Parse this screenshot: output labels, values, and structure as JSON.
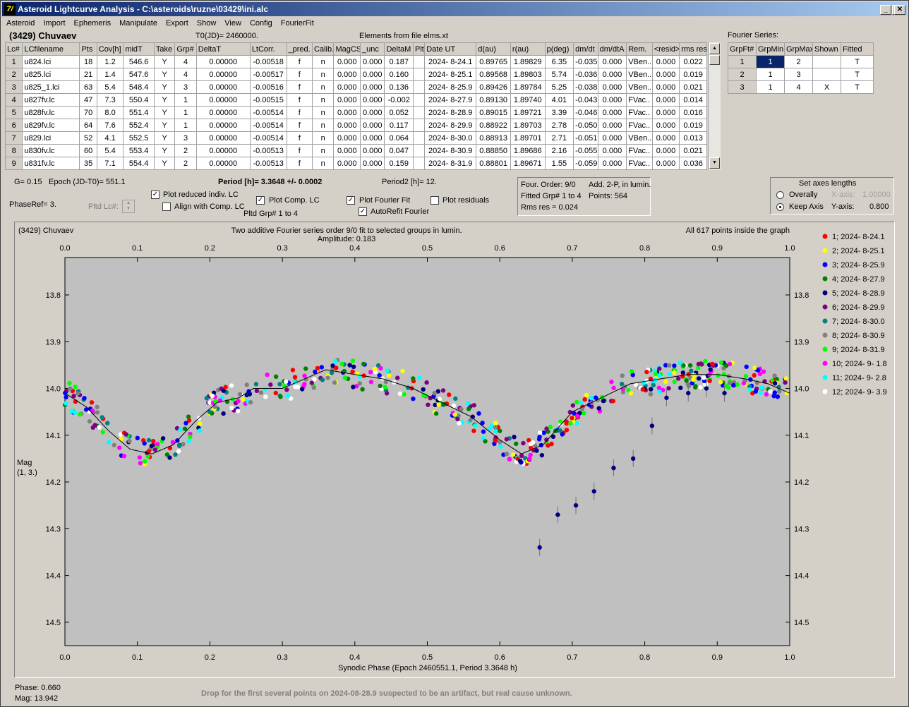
{
  "window": {
    "title": "Asteroid Lightcurve Analysis - C:\\asteroids\\ruzne\\03429\\ini.alc",
    "icon": "7/",
    "min_label": "_",
    "max_label": "□",
    "close_label": "✕"
  },
  "menu": [
    "Asteroid",
    "Import",
    "Ephemeris",
    "Manipulate",
    "Export",
    "Show",
    "View",
    "Config",
    "FourierFit"
  ],
  "header": {
    "asteroid": "(3429) Chuvaev",
    "t0": "T0(JD)= 2460000.",
    "elements": "Elements from file elms.xt"
  },
  "lc_table": {
    "columns": [
      "Lc#",
      "LCfilename",
      "Pts",
      "Cov[h]",
      "midT",
      "Take",
      "Grp#",
      "DeltaT",
      "LtCorr.",
      "_pred.",
      "Calib.",
      "MagCS",
      "_unc",
      "DeltaM",
      "Plt",
      "Date UT",
      "d(au)",
      "r(au)",
      "p(deg)",
      "dm/dt",
      "dm/dtA",
      "Rem.",
      "<resid>",
      "rms res"
    ],
    "rows": [
      [
        "1",
        "u824.lci",
        "18",
        "1.2",
        "546.6",
        "Y",
        "4",
        "0.00000",
        "-0.00518",
        "f",
        "n",
        "0.000",
        "0.000",
        "0.187",
        "",
        "2024- 8-24.1",
        "0.89765",
        "1.89829",
        "6.35",
        "-0.035",
        "0.000",
        "VBen..",
        "0.000",
        "0.022"
      ],
      [
        "2",
        "u825.lci",
        "21",
        "1.4",
        "547.6",
        "Y",
        "4",
        "0.00000",
        "-0.00517",
        "f",
        "n",
        "0.000",
        "0.000",
        "0.160",
        "",
        "2024- 8-25.1",
        "0.89568",
        "1.89803",
        "5.74",
        "-0.036",
        "0.000",
        "VBen..",
        "0.000",
        "0.019"
      ],
      [
        "3",
        "u825_1.lci",
        "63",
        "5.4",
        "548.4",
        "Y",
        "3",
        "0.00000",
        "-0.00516",
        "f",
        "n",
        "0.000",
        "0.000",
        "0.136",
        "",
        "2024- 8-25.9",
        "0.89426",
        "1.89784",
        "5.25",
        "-0.038",
        "0.000",
        "VBen..",
        "0.000",
        "0.021"
      ],
      [
        "4",
        "u827fv.lc",
        "47",
        "7.3",
        "550.4",
        "Y",
        "1",
        "0.00000",
        "-0.00515",
        "f",
        "n",
        "0.000",
        "0.000",
        "-0.002",
        "",
        "2024- 8-27.9",
        "0.89130",
        "1.89740",
        "4.01",
        "-0.043",
        "0.000",
        "FVac..",
        "0.000",
        "0.014"
      ],
      [
        "5",
        "u828fv.lc",
        "70",
        "8.0",
        "551.4",
        "Y",
        "1",
        "0.00000",
        "-0.00514",
        "f",
        "n",
        "0.000",
        "0.000",
        "0.052",
        "",
        "2024- 8-28.9",
        "0.89015",
        "1.89721",
        "3.39",
        "-0.046",
        "0.000",
        "FVac..",
        "0.000",
        "0.016"
      ],
      [
        "6",
        "u829fv.lc",
        "64",
        "7.6",
        "552.4",
        "Y",
        "1",
        "0.00000",
        "-0.00514",
        "f",
        "n",
        "0.000",
        "0.000",
        "0.117",
        "",
        "2024- 8-29.9",
        "0.88922",
        "1.89703",
        "2.78",
        "-0.050",
        "0.000",
        "FVac..",
        "0.000",
        "0.019"
      ],
      [
        "7",
        "u829.lci",
        "52",
        "4.1",
        "552.5",
        "Y",
        "3",
        "0.00000",
        "-0.00514",
        "f",
        "n",
        "0.000",
        "0.000",
        "0.064",
        "",
        "2024- 8-30.0",
        "0.88913",
        "1.89701",
        "2.71",
        "-0.051",
        "0.000",
        "VBen..",
        "0.000",
        "0.013"
      ],
      [
        "8",
        "u830fv.lc",
        "60",
        "5.4",
        "553.4",
        "Y",
        "2",
        "0.00000",
        "-0.00513",
        "f",
        "n",
        "0.000",
        "0.000",
        "0.047",
        "",
        "2024- 8-30.9",
        "0.88850",
        "1.89686",
        "2.16",
        "-0.055",
        "0.000",
        "FVac..",
        "0.000",
        "0.021"
      ],
      [
        "9",
        "u831fv.lc",
        "35",
        "7.1",
        "554.4",
        "Y",
        "2",
        "0.00000",
        "-0.00513",
        "f",
        "n",
        "0.000",
        "0.000",
        "0.159",
        "",
        "2024- 8-31.9",
        "0.88801",
        "1.89671",
        "1.55",
        "-0.059",
        "0.000",
        "FVac..",
        "0.000",
        "0.036"
      ]
    ]
  },
  "fourier_table": {
    "title": "Fourier Series:",
    "columns": [
      "GrpFt#",
      "GrpMin",
      "GrpMax",
      "Shown",
      "Fitted"
    ],
    "rows": [
      [
        "1",
        "1",
        "2",
        "",
        "T"
      ],
      [
        "2",
        "1",
        "3",
        "",
        "T"
      ],
      [
        "3",
        "1",
        "4",
        "X",
        "T"
      ]
    ]
  },
  "params": {
    "g": "G= 0.15",
    "epoch": "Epoch (JD-T0)= 551.1",
    "period": "Period [h]= 3.3648 +/- 0.0002",
    "period2": "Period2 [h]= 12.",
    "phaseref": "PhaseRef= 3.",
    "pltd_lc": "Pltd Lc#:"
  },
  "checks": {
    "plot_reduced": "Plot reduced indiv. LC",
    "align": "Align with Comp. LC",
    "plot_comp": "Plot Comp. LC",
    "pltd_grp": "Pltd Grp#  1   to   4",
    "plot_fourier": "Plot Fourier Fit",
    "autorefit": "AutoRefit Fourier",
    "plot_resid": "Plot residuals"
  },
  "fit_info": {
    "order": "Four. Order:  9/0",
    "add": "Add. 2-P, in lumin.",
    "fitted": "Fitted Grp# 1 to 4",
    "points": "Points: 564",
    "rms": "Rms res      = 0.024"
  },
  "axes_box": {
    "title": "Set axes lengths",
    "overall": "Overally",
    "keep": "Keep Axis",
    "xaxis": "X-axis:",
    "xval": "1.00000",
    "yaxis": "Y-axis:",
    "yval": "0.800"
  },
  "chart_data": {
    "type": "scatter",
    "title_left": "(3429) Chuvaev",
    "title": "Two additive Fourier series order 9/0 fit to selected groups in lumin.",
    "subtitle": "Amplitude: 0.183",
    "note": "All 617 points inside the graph",
    "xlabel": "Synodic Phase (Epoch 2460551.1, Period 3.3648 h)",
    "ylabel": "Mag",
    "ylabel2": "(1, 3.)",
    "xlim": [
      0,
      1
    ],
    "ylim": [
      14.55,
      13.72
    ],
    "xticks": [
      "0.0",
      "0.1",
      "0.2",
      "0.3",
      "0.4",
      "0.5",
      "0.6",
      "0.7",
      "0.8",
      "0.9",
      "1.0"
    ],
    "yticks": [
      "13.8",
      "13.9",
      "14.0",
      "14.1",
      "14.2",
      "14.3",
      "14.4",
      "14.5"
    ],
    "legend": [
      {
        "name": "1; 2024- 8-24.1",
        "color": "#ff0000"
      },
      {
        "name": "2; 2024- 8-25.1",
        "color": "#ffff00"
      },
      {
        "name": "3; 2024- 8-25.9",
        "color": "#0000ff"
      },
      {
        "name": "4; 2024- 8-27.9",
        "color": "#008000"
      },
      {
        "name": "5; 2024- 8-28.9",
        "color": "#000080"
      },
      {
        "name": "6; 2024- 8-29.9",
        "color": "#800080"
      },
      {
        "name": "7; 2024- 8-30.0",
        "color": "#008080"
      },
      {
        "name": "8; 2024- 8-30.9",
        "color": "#808080"
      },
      {
        "name": "9; 2024- 8-31.9",
        "color": "#00ff00"
      },
      {
        "name": "10; 2024- 9- 1.8",
        "color": "#ff00ff"
      },
      {
        "name": "11; 2024- 9- 2.8",
        "color": "#00ffff"
      },
      {
        "name": "12; 2024- 9- 3.9",
        "color": "#ffffff"
      }
    ],
    "fit_curve": [
      [
        0,
        14.01
      ],
      [
        0.03,
        14.04
      ],
      [
        0.06,
        14.09
      ],
      [
        0.09,
        14.13
      ],
      [
        0.12,
        14.14
      ],
      [
        0.15,
        14.12
      ],
      [
        0.18,
        14.07
      ],
      [
        0.21,
        14.03
      ],
      [
        0.24,
        14.02
      ],
      [
        0.26,
        14.0
      ],
      [
        0.3,
        14.0
      ],
      [
        0.33,
        13.98
      ],
      [
        0.36,
        13.96
      ],
      [
        0.4,
        13.97
      ],
      [
        0.44,
        13.98
      ],
      [
        0.48,
        14.0
      ],
      [
        0.52,
        14.03
      ],
      [
        0.56,
        14.06
      ],
      [
        0.6,
        14.11
      ],
      [
        0.63,
        14.14
      ],
      [
        0.66,
        14.12
      ],
      [
        0.7,
        14.05
      ],
      [
        0.74,
        14.02
      ],
      [
        0.78,
        13.99
      ],
      [
        0.82,
        13.98
      ],
      [
        0.86,
        13.97
      ],
      [
        0.9,
        13.97
      ],
      [
        0.94,
        13.98
      ],
      [
        0.97,
        13.99
      ],
      [
        1.0,
        14.01
      ]
    ],
    "outlier_points": [
      [
        0.655,
        14.34
      ],
      [
        0.68,
        14.27
      ],
      [
        0.705,
        14.25
      ],
      [
        0.73,
        14.22
      ],
      [
        0.757,
        14.17
      ],
      [
        0.784,
        14.15
      ],
      [
        0.81,
        14.08
      ],
      [
        0.83,
        14.02
      ],
      [
        0.86,
        14.01
      ],
      [
        0.885,
        14.0
      ],
      [
        0.91,
        14.01
      ]
    ]
  },
  "status": {
    "phase": "Phase:  0.660",
    "mag": "Mag:    13.942",
    "note": "Drop for the first several points on 2024-08-28.9 suspected to be an artifact, but real cause unknown."
  }
}
